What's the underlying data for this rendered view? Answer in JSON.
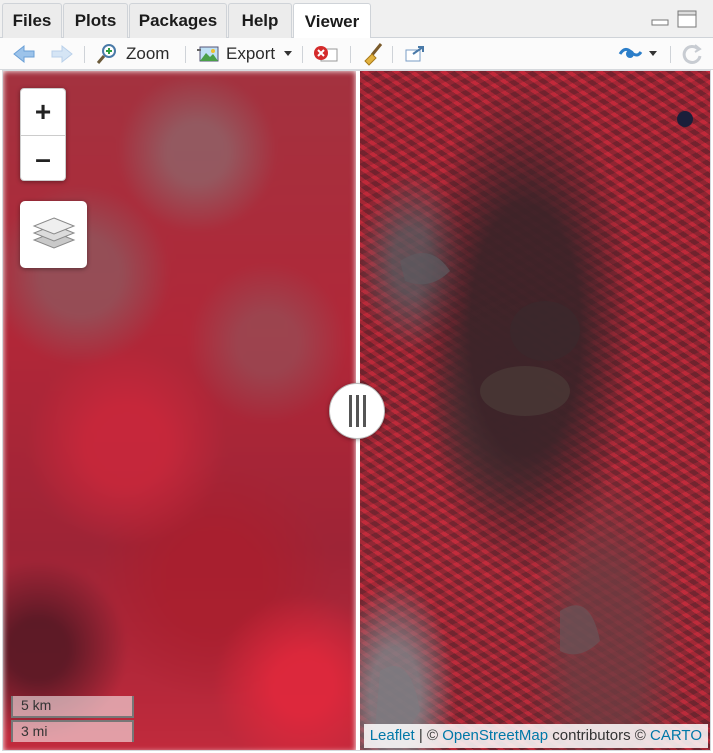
{
  "tabs": [
    {
      "label": "Files",
      "active": false
    },
    {
      "label": "Plots",
      "active": false
    },
    {
      "label": "Packages",
      "active": false
    },
    {
      "label": "Help",
      "active": false
    },
    {
      "label": "Viewer",
      "active": true
    }
  ],
  "toolbar": {
    "zoom_label": "Zoom",
    "export_label": "Export",
    "icons": [
      "back-arrow-icon",
      "forward-arrow-icon",
      "zoom-magnifier-icon",
      "export-image-icon",
      "remove-viewer-icon",
      "broom-clear-icon",
      "popout-icon",
      "sync-icon",
      "refresh-icon"
    ]
  },
  "map": {
    "zoom_in": "+",
    "zoom_out": "–",
    "scale_km": "5 km",
    "scale_mi": "3 mi",
    "attribution": {
      "leaflet": "Leaflet",
      "sep1": " | © ",
      "osm": "OpenStreetMap",
      "mid": " contributors © ",
      "carto": "CARTO"
    },
    "colors": {
      "accent": "#2c7ec9",
      "link": "#0078a8",
      "imagery_red": "#c2283d"
    }
  }
}
